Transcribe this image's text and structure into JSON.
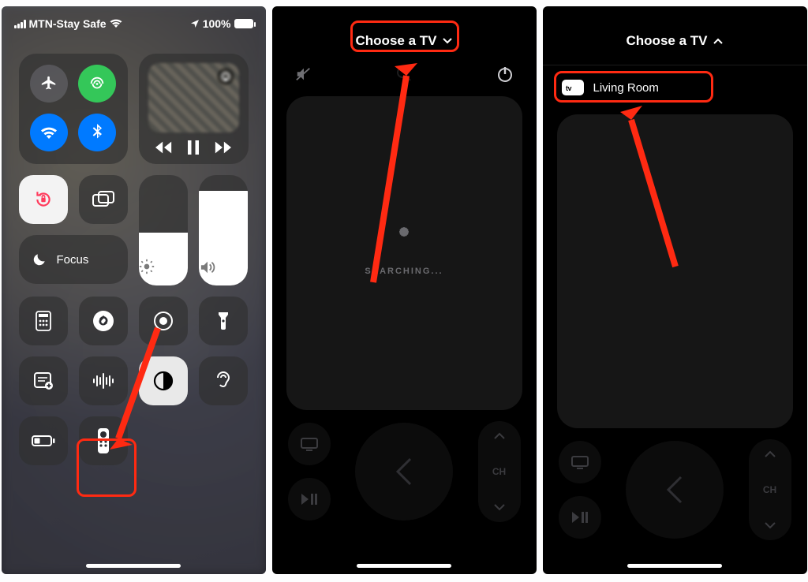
{
  "status": {
    "carrier": "MTN-Stay Safe",
    "battery_pct": "100%",
    "location_icon": "◉"
  },
  "control_center": {
    "focus_label": "Focus",
    "brightness_fill_pct": 48,
    "volume_fill_pct": 86,
    "icons": {
      "airplane": "airplane-icon",
      "cellular": "cellular-icon",
      "wifi": "wifi-icon",
      "bluetooth": "bluetooth-icon",
      "airplay": "airplay-icon",
      "rewind": "rewind-icon",
      "pause": "pause-icon",
      "forward": "forward-icon",
      "rotation_lock": "rotation-lock-icon",
      "screen_mirror": "screen-mirror-icon",
      "moon": "moon-icon",
      "brightness": "brightness-icon",
      "volume": "volume-icon",
      "calculator": "calculator-icon",
      "shazam": "shazam-icon",
      "record": "screen-record-icon",
      "flashlight": "flashlight-icon",
      "notes": "quick-note-icon",
      "sound_recognition": "sound-recognition-icon",
      "dark_mode": "dark-mode-icon",
      "hearing": "hearing-icon",
      "low_power": "low-power-icon",
      "remote": "apple-tv-remote-icon"
    }
  },
  "remote": {
    "choose_label": "Choose a TV",
    "searching_label": "SEARCHING...",
    "channel_label": "CH",
    "devices": [
      {
        "badge": "tv",
        "name": "Living Room"
      }
    ],
    "icons": {
      "mute": "mute-icon",
      "power": "power-icon",
      "tv": "tv-icon",
      "play_pause": "play-pause-icon",
      "back": "back-icon",
      "ch_up": "chevron-up-icon",
      "ch_down": "chevron-down-icon"
    }
  },
  "annotations": {
    "highlight_color": "#ff2a12"
  }
}
